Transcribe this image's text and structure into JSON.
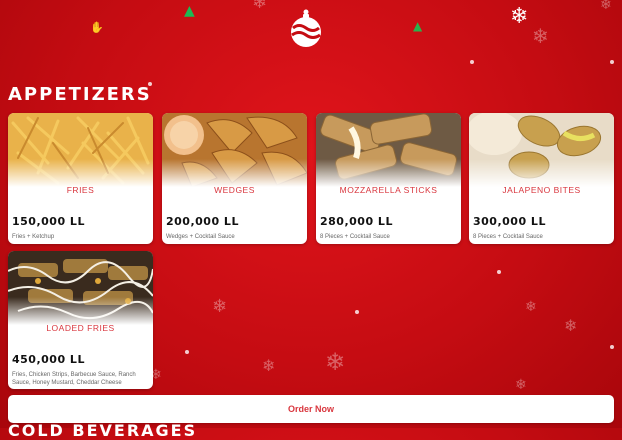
{
  "header": {
    "logo_icon": "ornament-logo"
  },
  "appetizers": {
    "title": "APPETIZERS",
    "items": [
      {
        "name": "FRIES",
        "price": "150,000 LL",
        "desc": "Fries + Ketchup"
      },
      {
        "name": "WEDGES",
        "price": "200,000 LL",
        "desc": "Wedges + Cocktail Sauce"
      },
      {
        "name": "MOZZARELLA STICKS",
        "price": "280,000 LL",
        "desc": "8 Pieces + Cocktail Sauce"
      },
      {
        "name": "JALAPENO BITES",
        "price": "300,000 LL",
        "desc": "8 Pieces + Cocktail Sauce"
      },
      {
        "name": "LOADED FRIES",
        "price": "450,000 LL",
        "desc": "Fries, Chicken Strips, Barbecue Sauce, Ranch Sauce, Honey Mustard, Cheddar Cheese"
      }
    ]
  },
  "order_button": {
    "label": "Order Now"
  },
  "next_section": {
    "title": "COLD BEVERAGES"
  },
  "colors": {
    "background": "#c50c12",
    "accent": "#d9363e",
    "card": "#ffffff"
  }
}
